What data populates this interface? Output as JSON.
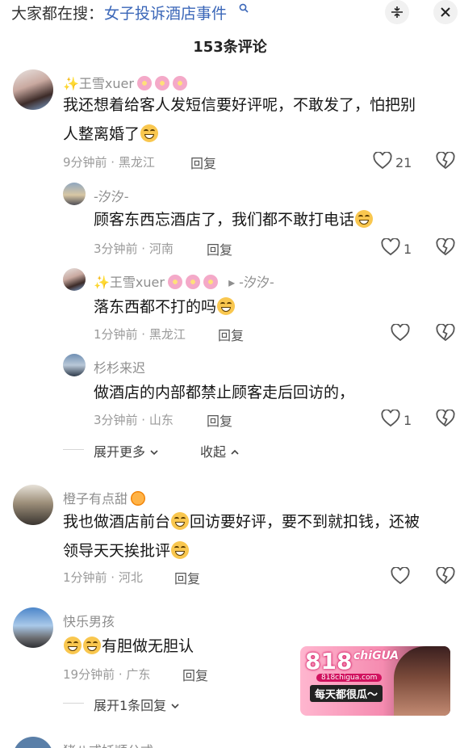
{
  "search": {
    "prefix": "大家都在搜：",
    "term": "女子投诉酒店事件",
    "search_icon": "search-icon"
  },
  "header": {
    "collapse_icon": "collapse-icon",
    "close_icon": "close-icon",
    "comment_count": "153条评论"
  },
  "comments": [
    {
      "user": "✨王雪xuer",
      "text1": "我还想着给客人发短信要好评呢，不敢发了，怕把别",
      "text2": "人整离婚了",
      "time_loc": "9分钟前 · 黑龙江",
      "reply": "回复",
      "likes": "21"
    },
    {
      "user": "-汐汐-",
      "text1": "顾客东西忘酒店了，我们都不敢打电话",
      "time_loc": "3分钟前 · 河南",
      "reply": "回复",
      "likes": "1"
    },
    {
      "user": "✨王雪xuer",
      "reply_to": "▸ -汐汐-",
      "text1": "落东西都不打的吗",
      "time_loc": "1分钟前 · 黑龙江",
      "reply": "回复",
      "likes": ""
    },
    {
      "user": "杉杉来迟",
      "text1": "做酒店的内部都禁止顾客走后回访的，",
      "time_loc": "3分钟前 · 山东",
      "reply": "回复",
      "likes": "1"
    },
    {
      "user": "橙子有点甜",
      "text1": "我也做酒店前台",
      "text1b": "回访要好评，要不到就扣钱，还被",
      "text2": "领导天天挨批评",
      "time_loc": "1分钟前 · 河北",
      "reply": "回复",
      "likes": ""
    },
    {
      "user": "快乐男孩",
      "text1": "有胆做无胆认",
      "time_loc": "19分钟前 · 广东",
      "reply": "回复",
      "likes": ""
    }
  ],
  "thread_controls": {
    "expand_more": "展开更多",
    "collapse": "收起",
    "expand_one": "展开1条回复"
  },
  "next_user": "猪八戒妖顺公式",
  "ad": {
    "logo_number": "818",
    "logo_text": "chiGUA",
    "url": "818chigua.com",
    "slogan": "每天都很瓜～"
  }
}
